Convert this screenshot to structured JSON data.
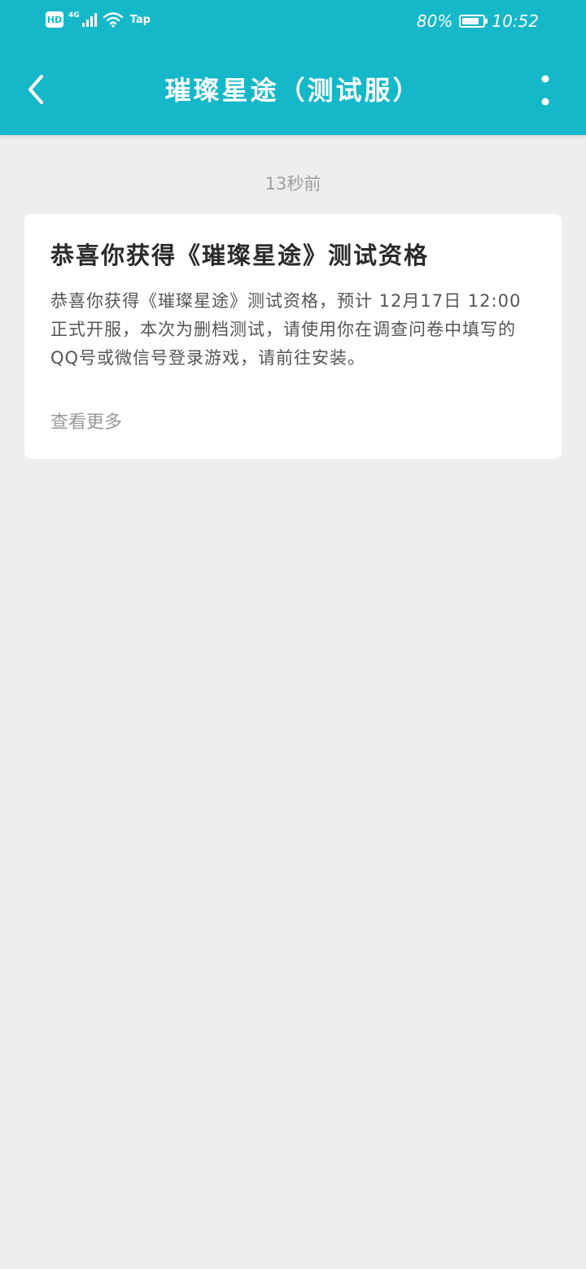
{
  "status_bar": {
    "hd": "HD",
    "network": "4G",
    "tap": "Tap",
    "battery_text": "80%",
    "battery_level": 0.8,
    "time": "10:52"
  },
  "app_bar": {
    "title": "璀璨星途（测试服）"
  },
  "message": {
    "timestamp": "13秒前",
    "title": "恭喜你获得《璀璨星途》测试资格",
    "body": "恭喜你获得《璀璨星途》测试资格，预计 12月17日 12:00 正式开服，本次为删档测试，请使用你在调查问卷中填写的QQ号或微信号登录游戏，请前往安装。",
    "more_label": "查看更多"
  },
  "colors": {
    "header": "#15b8c8",
    "background": "#eeeeee",
    "card": "#ffffff"
  }
}
